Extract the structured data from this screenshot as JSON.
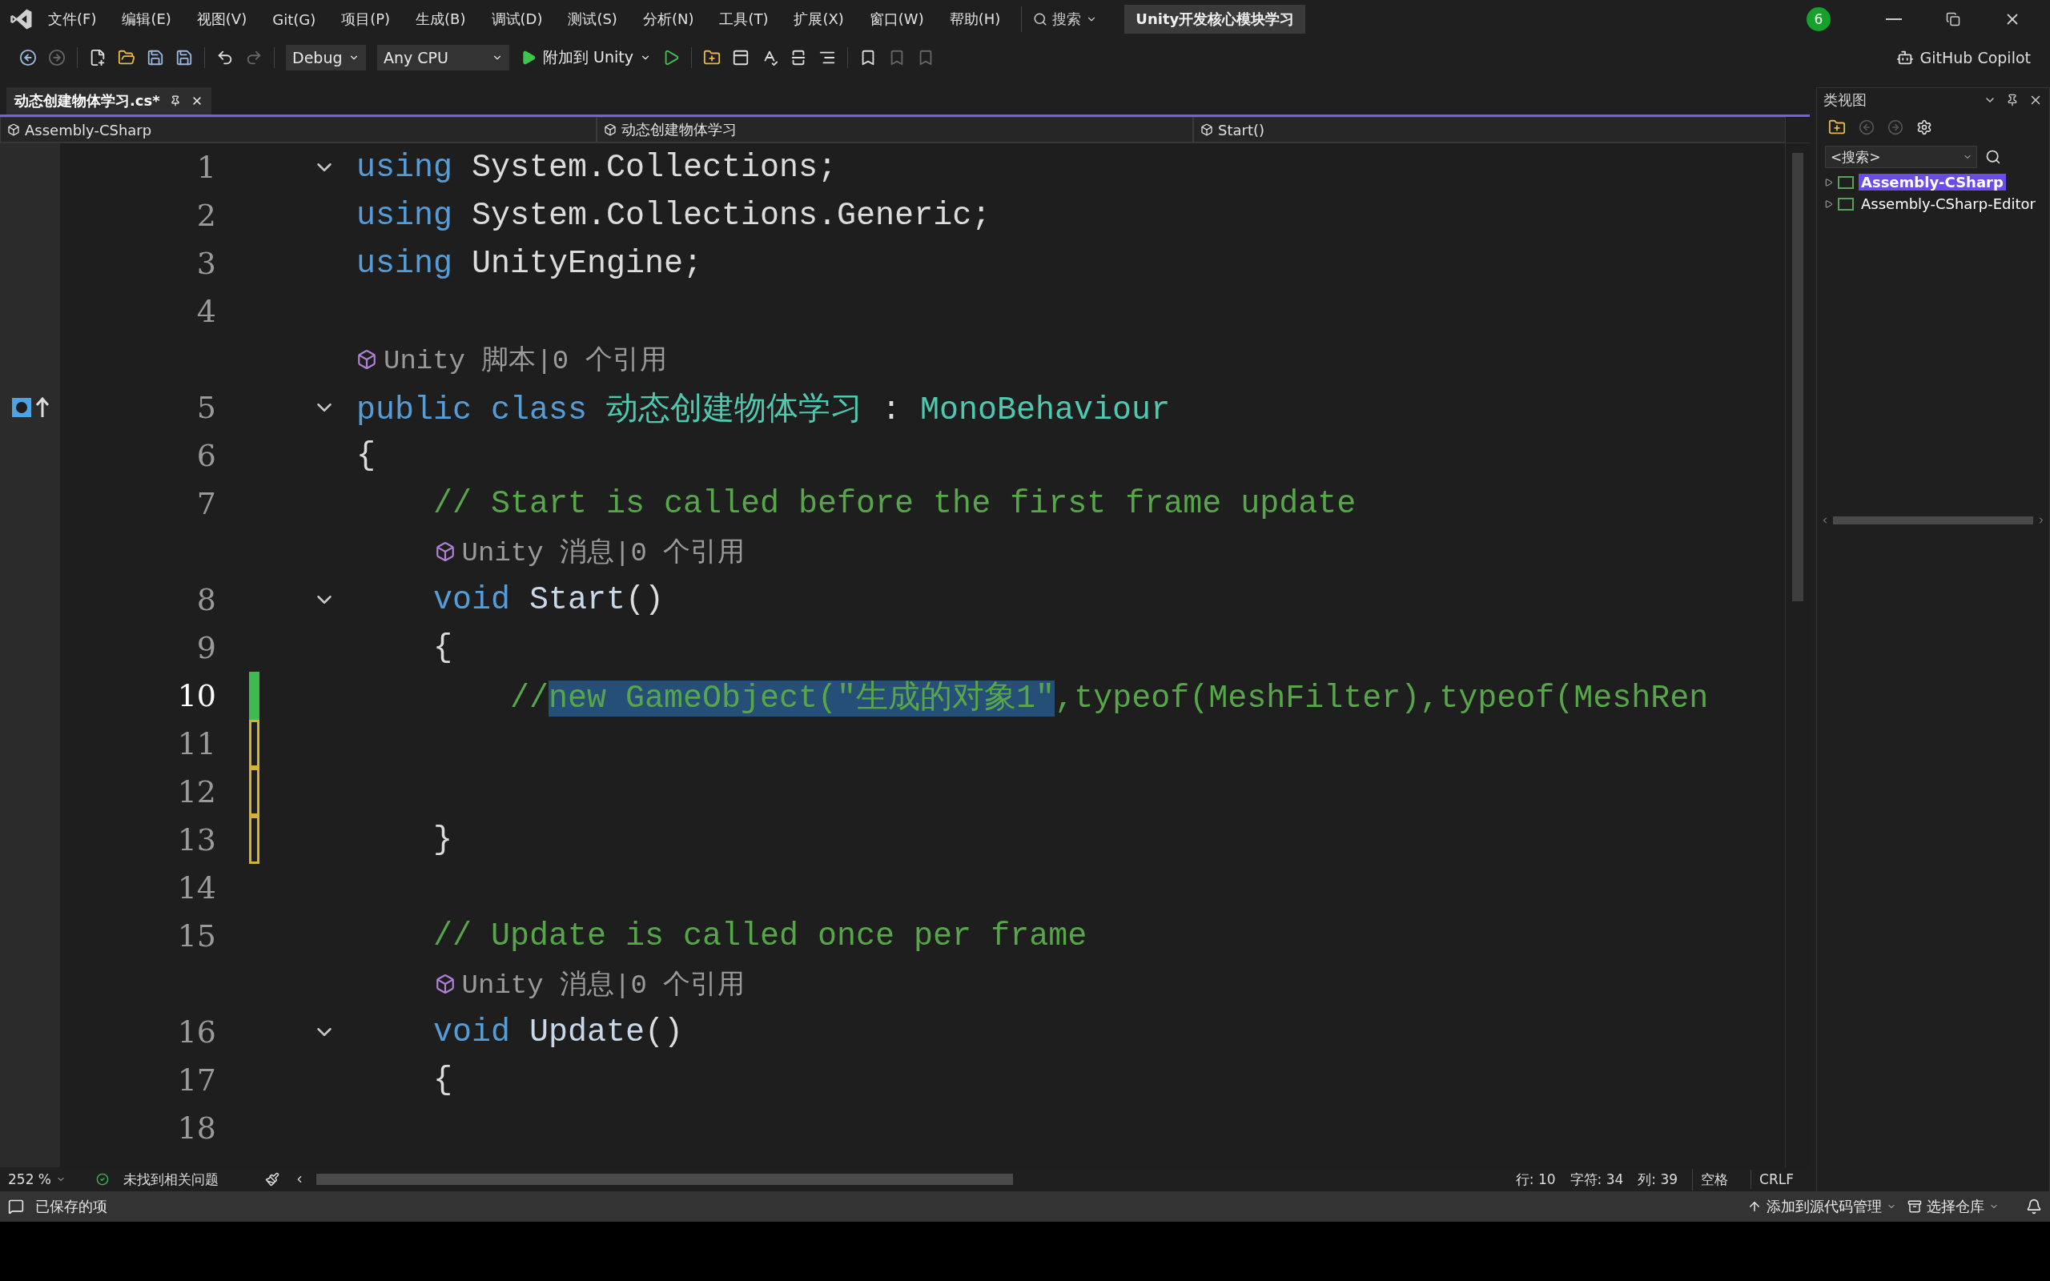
{
  "menu": [
    {
      "label": "文件(F)"
    },
    {
      "label": "编辑(E)"
    },
    {
      "label": "视图(V)"
    },
    {
      "label": "Git(G)"
    },
    {
      "label": "项目(P)"
    },
    {
      "label": "生成(B)"
    },
    {
      "label": "调试(D)"
    },
    {
      "label": "测试(S)"
    },
    {
      "label": "分析(N)"
    },
    {
      "label": "工具(T)"
    },
    {
      "label": "扩展(X)"
    },
    {
      "label": "窗口(W)"
    },
    {
      "label": "帮助(H)"
    }
  ],
  "search": {
    "label": "搜索"
  },
  "solution_name": "Unity开发核心模块学习",
  "notification_count": "6",
  "toolbar": {
    "configuration": "Debug",
    "platform": "Any CPU",
    "run_label": "附加到 Unity",
    "copilot": "GitHub Copilot"
  },
  "tabs": [
    {
      "label": "动态创建物体学习.cs*",
      "selected": true
    }
  ],
  "nav": {
    "project": "Assembly-CSharp",
    "class": "动态创建物体学习",
    "member": "Start()"
  },
  "code_lines": [
    {
      "kind": "code",
      "number": "1",
      "fold": true,
      "current": false,
      "tokens": [
        {
          "t": "using",
          "kind": "kw"
        },
        {
          "t": " System.Collections;",
          "kind": "plain"
        }
      ]
    },
    {
      "kind": "code",
      "number": "2",
      "fold": false,
      "current": false,
      "tokens": [
        {
          "t": "using",
          "kind": "kw"
        },
        {
          "t": " System.Collections.Generic;",
          "kind": "plain"
        }
      ]
    },
    {
      "kind": "code",
      "number": "3",
      "fold": false,
      "current": false,
      "tokens": [
        {
          "t": "using",
          "kind": "kw"
        },
        {
          "t": " UnityEngine;",
          "kind": "plain"
        }
      ]
    },
    {
      "kind": "code",
      "number": "4",
      "fold": false,
      "current": false
    },
    {
      "kind": "lens",
      "text": "Unity 脚本|0 个引用"
    },
    {
      "kind": "code",
      "number": "5",
      "fold": true,
      "current": false,
      "margin_glyph": true,
      "tokens": [
        {
          "t": "public class",
          "kind": "kw"
        },
        {
          "t": " 动态创建物体学习",
          "kind": "type"
        },
        {
          "t": " : ",
          "kind": "plain"
        },
        {
          "t": "MonoBehaviour",
          "kind": "type"
        }
      ]
    },
    {
      "kind": "code",
      "number": "6",
      "fold": false,
      "current": false,
      "tokens": [
        {
          "t": "{",
          "kind": "plain"
        }
      ]
    },
    {
      "kind": "code",
      "number": "7",
      "fold": false,
      "current": false,
      "tokens": [
        {
          "t": "    // Start is called before the first frame update",
          "kind": "comment"
        }
      ]
    },
    {
      "kind": "lens",
      "text": "Unity 消息|0 个引用"
    },
    {
      "kind": "code",
      "number": "8",
      "fold": true,
      "current": false,
      "tokens": [
        {
          "t": "    void",
          "kind": "kw"
        },
        {
          "t": " Start",
          "kind": "method"
        },
        {
          "t": "()",
          "kind": "plain"
        }
      ]
    },
    {
      "kind": "code",
      "number": "9",
      "fold": false,
      "current": false,
      "tokens": [
        {
          "t": "    {",
          "kind": "plain"
        }
      ]
    },
    {
      "kind": "code",
      "number": "10",
      "fold": false,
      "current": true,
      "changed": true,
      "saved": true,
      "tokens": [
        {
          "t": "        //",
          "kind": "comment",
          "selected": false
        },
        {
          "t": "new GameObject(\"生成的对象1\"",
          "kind": "comment",
          "selected": true
        },
        {
          "t": ",typeof(MeshFilter),typeof(MeshRen",
          "kind": "comment",
          "selected": false
        }
      ]
    },
    {
      "kind": "code",
      "number": "11",
      "fold": false,
      "current": false,
      "changed": true,
      "saved": false
    },
    {
      "kind": "code",
      "number": "12",
      "fold": false,
      "current": false,
      "changed": true,
      "saved": false
    },
    {
      "kind": "code",
      "number": "13",
      "fold": false,
      "current": false,
      "changed": true,
      "saved": false,
      "tokens": [
        {
          "t": "    }",
          "kind": "plain"
        }
      ]
    },
    {
      "kind": "code",
      "number": "14",
      "fold": false,
      "current": false
    },
    {
      "kind": "code",
      "number": "15",
      "fold": false,
      "current": false,
      "tokens": [
        {
          "t": "    // Update is called once per frame",
          "kind": "comment"
        }
      ]
    },
    {
      "kind": "lens",
      "text": "Unity 消息|0 个引用"
    },
    {
      "kind": "code",
      "number": "16",
      "fold": true,
      "current": false,
      "tokens": [
        {
          "t": "    void",
          "kind": "kw"
        },
        {
          "t": " Update",
          "kind": "method"
        },
        {
          "t": "()",
          "kind": "plain"
        }
      ]
    },
    {
      "kind": "code",
      "number": "17",
      "fold": false,
      "current": false,
      "tokens": [
        {
          "t": "    {",
          "kind": "plain"
        }
      ]
    },
    {
      "kind": "code",
      "number": "18",
      "fold": false,
      "current": false
    }
  ],
  "editor_status": {
    "zoom": "252 %",
    "issues": "未找到相关问题",
    "line": "行: 10",
    "char": "字符: 34",
    "col": "列: 39",
    "whitespace": "空格",
    "eol": "CRLF"
  },
  "class_view": {
    "title": "类视图",
    "search_placeholder": "<搜索>",
    "items": [
      {
        "label": "Assembly-CSharp",
        "selected": true
      },
      {
        "label": "Assembly-CSharp-Editor",
        "selected": false
      }
    ]
  },
  "status_bar": {
    "message": "已保存的项",
    "source_control": "添加到源代码管理",
    "repository": "选择仓库"
  }
}
